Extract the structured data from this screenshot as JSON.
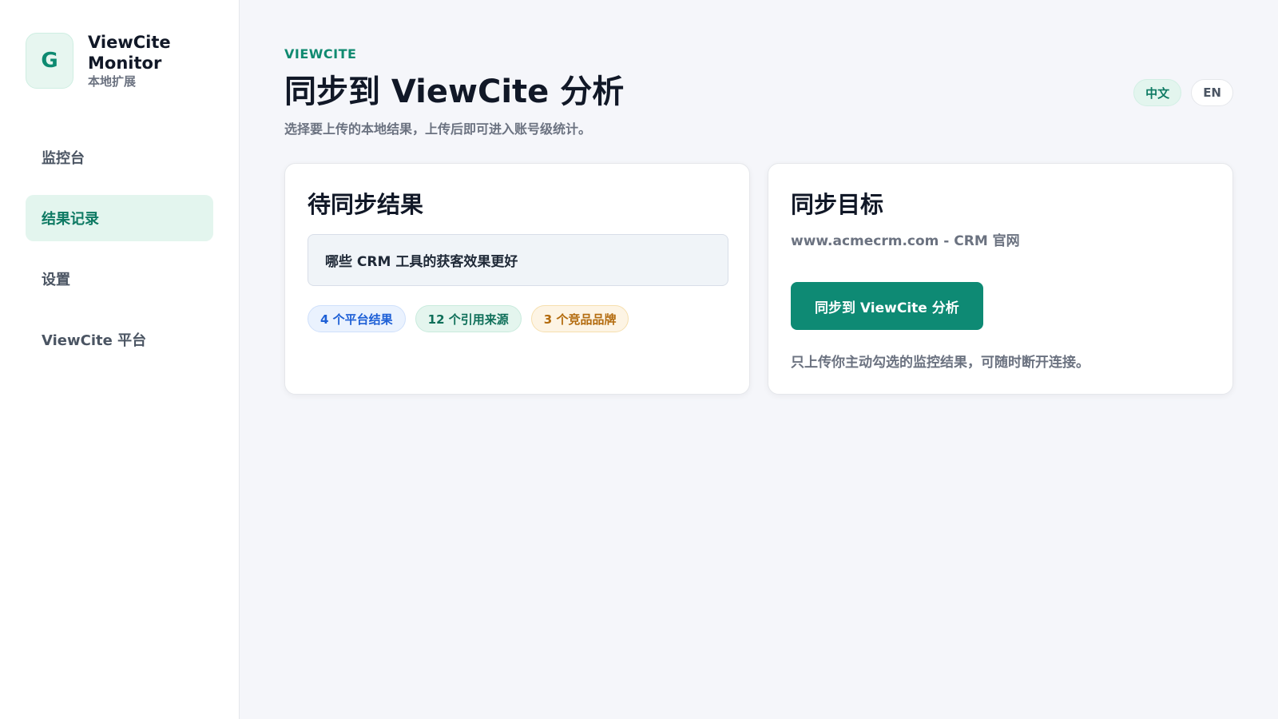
{
  "sidebar": {
    "brand": {
      "logo_letter": "G",
      "name": "ViewCite Monitor",
      "subtitle": "本地扩展"
    },
    "items": [
      {
        "label": "监控台",
        "active": false
      },
      {
        "label": "结果记录",
        "active": true
      },
      {
        "label": "设置",
        "active": false
      },
      {
        "label": "ViewCite 平台",
        "active": false
      }
    ]
  },
  "header": {
    "eyebrow": "VIEWCITE",
    "title": "同步到 ViewCite 分析",
    "subtitle": "选择要上传的本地结果，上传后即可进入账号级统计。",
    "languages": [
      {
        "label": "中文",
        "active": true
      },
      {
        "label": "EN",
        "active": false
      }
    ]
  },
  "pending": {
    "title": "待同步结果",
    "query": "哪些 CRM 工具的获客效果更好",
    "chips": {
      "platforms": "4 个平台结果",
      "sources": "12 个引用来源",
      "brands": "3 个竞品品牌"
    }
  },
  "target": {
    "title": "同步目标",
    "site": "www.acmecrm.com - CRM 官网",
    "button_label": "同步到 ViewCite 分析",
    "note": "只上传你主动勾选的监控结果，可随时断开连接。"
  },
  "colors": {
    "accent": "#0e8a74",
    "background": "#f5f6fa",
    "chip_blue": "#1d5fd6",
    "chip_green": "#0e6f59",
    "chip_amber": "#b36b0e"
  }
}
